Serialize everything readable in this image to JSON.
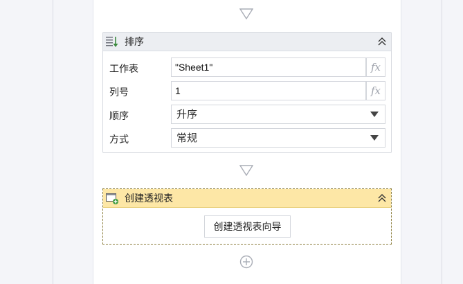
{
  "sort_activity": {
    "title": "排序",
    "rows": [
      {
        "label": "工作表",
        "value": "\"Sheet1\"",
        "fx": "fx"
      },
      {
        "label": "列号",
        "value": "1",
        "fx": "fx"
      }
    ],
    "order": {
      "label": "顺序",
      "value": "升序"
    },
    "method": {
      "label": "方式",
      "value": "常规"
    }
  },
  "pivot_activity": {
    "title": "创建透视表",
    "button_label": "创建透视表向导"
  },
  "icons": {
    "sort": "sort-list-icon",
    "collapse": "double-chevron-up-icon",
    "pivot": "pivot-table-add-icon",
    "connector": "triangle-down-icon",
    "add": "circle-plus-icon"
  },
  "colors": {
    "header_gray": "#eceef2",
    "header_yellow": "#fde7a6",
    "sort_icon_green": "#3b8a3e"
  }
}
